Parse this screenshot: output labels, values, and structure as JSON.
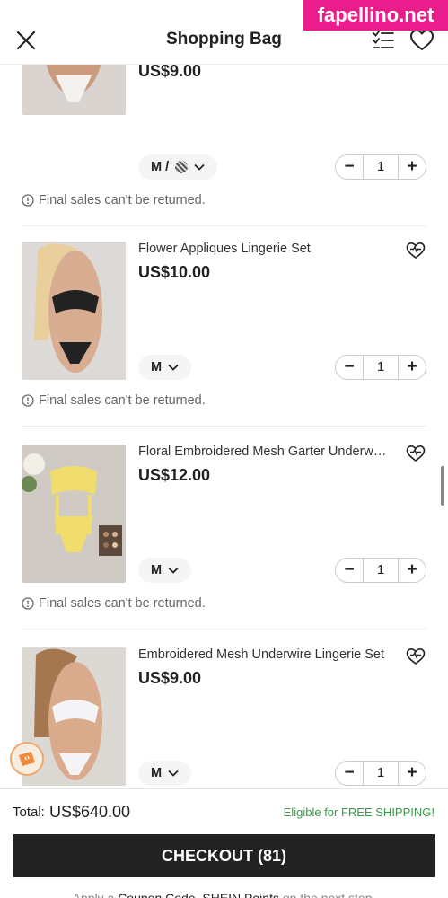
{
  "watermark": "fapellino.net",
  "header": {
    "title": "Shopping Bag",
    "icons": [
      "close-icon",
      "list-check-icon",
      "heart-icon"
    ]
  },
  "items": [
    {
      "name": "",
      "price": "US$9.00",
      "size": "M / ",
      "quantity": "1",
      "note": "Final sales can't be returned."
    },
    {
      "name": "Flower Appliques Lingerie Set",
      "price": "US$10.00",
      "size": "M",
      "quantity": "1",
      "note": "Final sales can't be returned."
    },
    {
      "name": "Floral Embroidered Mesh Garter Underwire Lingerie Set",
      "price": "US$12.00",
      "size": "M",
      "quantity": "1",
      "note": "Final sales can't be returned."
    },
    {
      "name": "Embroidered Mesh Underwire Lingerie Set",
      "price": "US$9.00",
      "size": "M",
      "quantity": "1",
      "note": ""
    }
  ],
  "footer": {
    "total_label": "Total:",
    "total_value": "US$640.00",
    "shipping": "Eligible for FREE SHIPPING!",
    "checkout_label": "CHECKOUT (81)",
    "hint_prefix": "Apply a",
    "hint_coupon": "Coupon Code",
    "hint_sep": ",",
    "hint_points": "SHEIN Points",
    "hint_suffix": "on the next step."
  },
  "colors": {
    "primary": "#222222",
    "success_text": "#3a9a4a",
    "watermark_bg": "#e91e8c"
  }
}
